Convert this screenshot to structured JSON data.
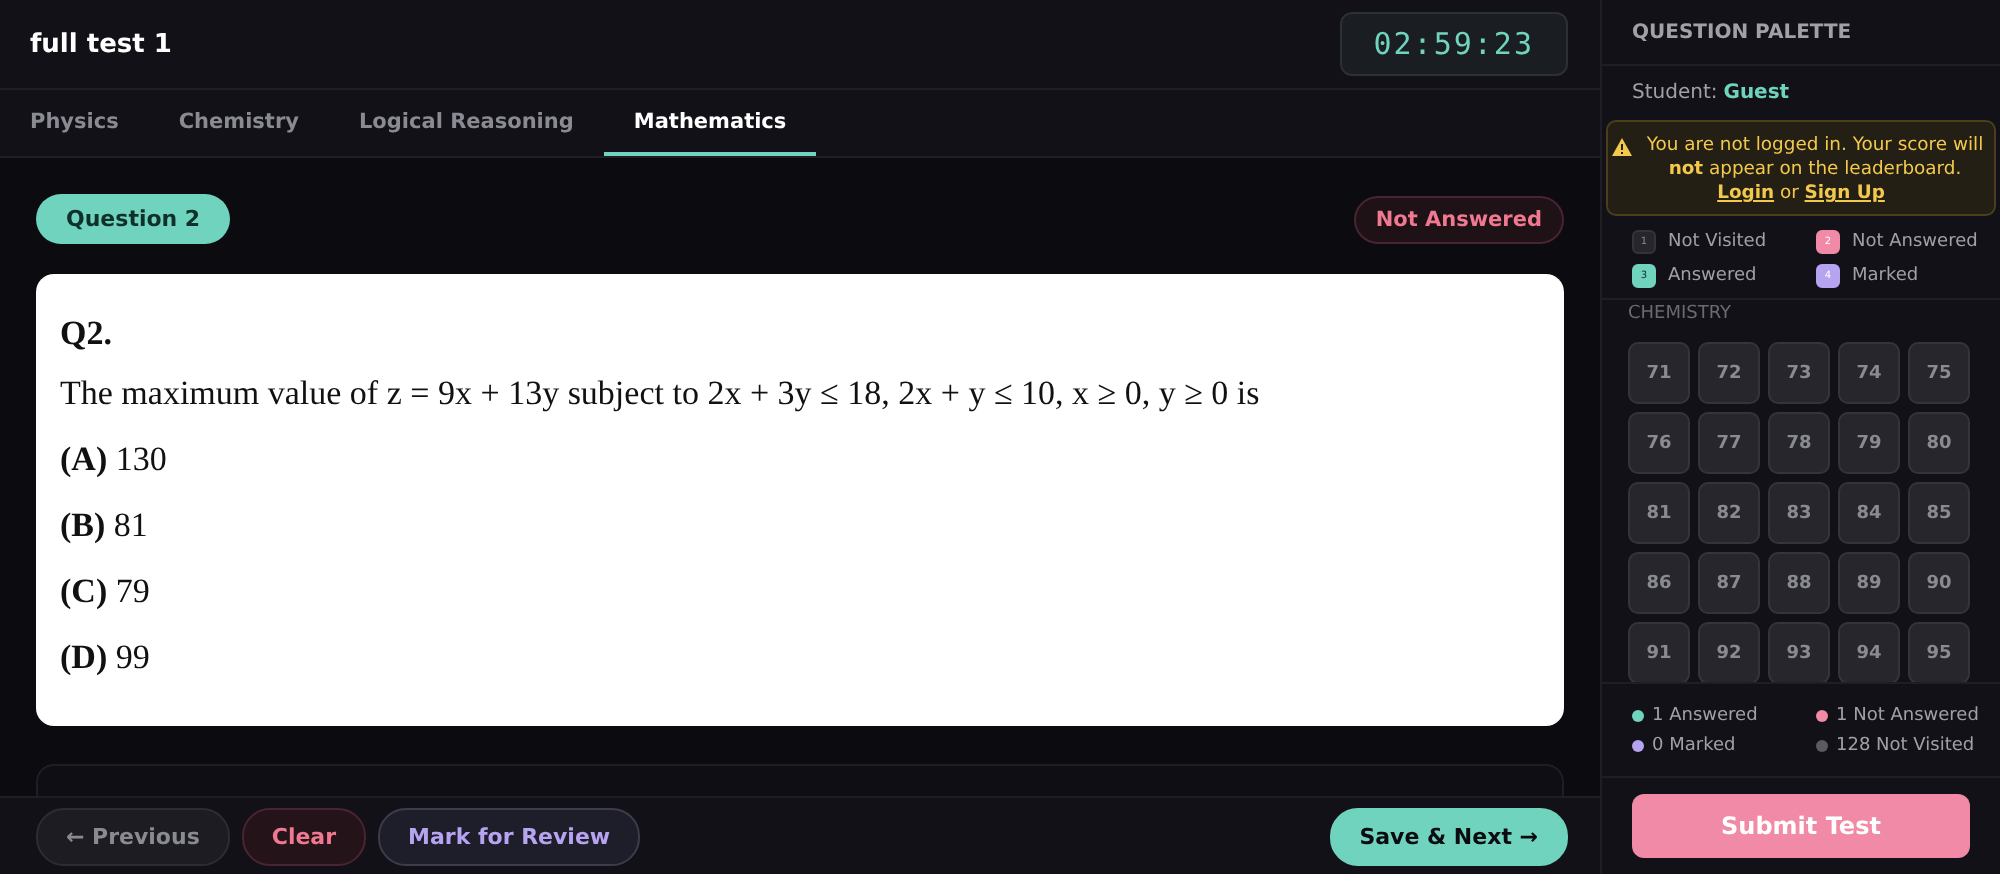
{
  "header": {
    "title": "full test 1",
    "timer": "02:59:23"
  },
  "tabs": [
    {
      "label": "Physics",
      "selected": false
    },
    {
      "label": "Chemistry",
      "selected": false
    },
    {
      "label": "Logical Reasoning",
      "selected": false
    },
    {
      "label": "Mathematics",
      "selected": true
    }
  ],
  "question": {
    "badge": "Question 2",
    "status": "Not Answered",
    "kind": "not_answered",
    "number": "Q2.",
    "text": "The maximum value of z = 9x + 13y subject to 2x + 3y ≤ 18, 2x + y ≤ 10, x ≥ 0, y ≥ 0 is",
    "options": [
      {
        "label": "(A)",
        "value": "130"
      },
      {
        "label": "(B)",
        "value": "81"
      },
      {
        "label": "(C)",
        "value": "79"
      },
      {
        "label": "(D)",
        "value": "99"
      }
    ]
  },
  "footer": {
    "buttons": [
      {
        "label": "← Previous",
        "kind": "previous"
      },
      {
        "label": "Clear",
        "kind": "clear"
      },
      {
        "label": "Mark for Review",
        "kind": "review"
      },
      {
        "label": "Save & Next →",
        "kind": "next"
      }
    ]
  },
  "sidebar": {
    "title": "QUESTION PALETTE",
    "student_label": "Student:",
    "student_name": "Guest",
    "warning": {
      "text": "You are not logged in. Your score will **not** appear on the leaderboard.",
      "login": "Login",
      "or": "or",
      "signup": "Sign Up"
    },
    "legend": [
      {
        "number": "1",
        "label": "Not Visited",
        "kind": "not_visited"
      },
      {
        "number": "2",
        "label": "Not Answered",
        "kind": "not_answered"
      },
      {
        "number": "3",
        "label": "Answered",
        "kind": "answered"
      },
      {
        "number": "4",
        "label": "Marked",
        "kind": "marked"
      }
    ],
    "section": "CHEMISTRY",
    "palette": [
      {
        "number": "71",
        "kind": "not_visited"
      },
      {
        "number": "72",
        "kind": "not_visited"
      },
      {
        "number": "73",
        "kind": "not_visited"
      },
      {
        "number": "74",
        "kind": "not_visited"
      },
      {
        "number": "75",
        "kind": "not_visited"
      },
      {
        "number": "76",
        "kind": "not_visited"
      },
      {
        "number": "77",
        "kind": "not_visited"
      },
      {
        "number": "78",
        "kind": "not_visited"
      },
      {
        "number": "79",
        "kind": "not_visited"
      },
      {
        "number": "80",
        "kind": "not_visited"
      },
      {
        "number": "81",
        "kind": "not_visited"
      },
      {
        "number": "82",
        "kind": "not_visited"
      },
      {
        "number": "83",
        "kind": "not_visited"
      },
      {
        "number": "84",
        "kind": "not_visited"
      },
      {
        "number": "85",
        "kind": "not_visited"
      },
      {
        "number": "86",
        "kind": "not_visited"
      },
      {
        "number": "87",
        "kind": "not_visited"
      },
      {
        "number": "88",
        "kind": "not_visited"
      },
      {
        "number": "89",
        "kind": "not_visited"
      },
      {
        "number": "90",
        "kind": "not_visited"
      },
      {
        "number": "91",
        "kind": "not_visited"
      },
      {
        "number": "92",
        "kind": "not_visited"
      },
      {
        "number": "93",
        "kind": "not_visited"
      },
      {
        "number": "94",
        "kind": "not_visited"
      },
      {
        "number": "95",
        "kind": "not_visited"
      }
    ],
    "summary": [
      {
        "text": "1 Answered",
        "color": "#6fd3bd"
      },
      {
        "text": "1 Not Answered",
        "color": "#f08aa6"
      },
      {
        "text": "0 Marked",
        "color": "#b6a4f0"
      },
      {
        "text": "128 Not Visited",
        "color": "#5a5a62"
      }
    ],
    "submit": "Submit Test"
  }
}
